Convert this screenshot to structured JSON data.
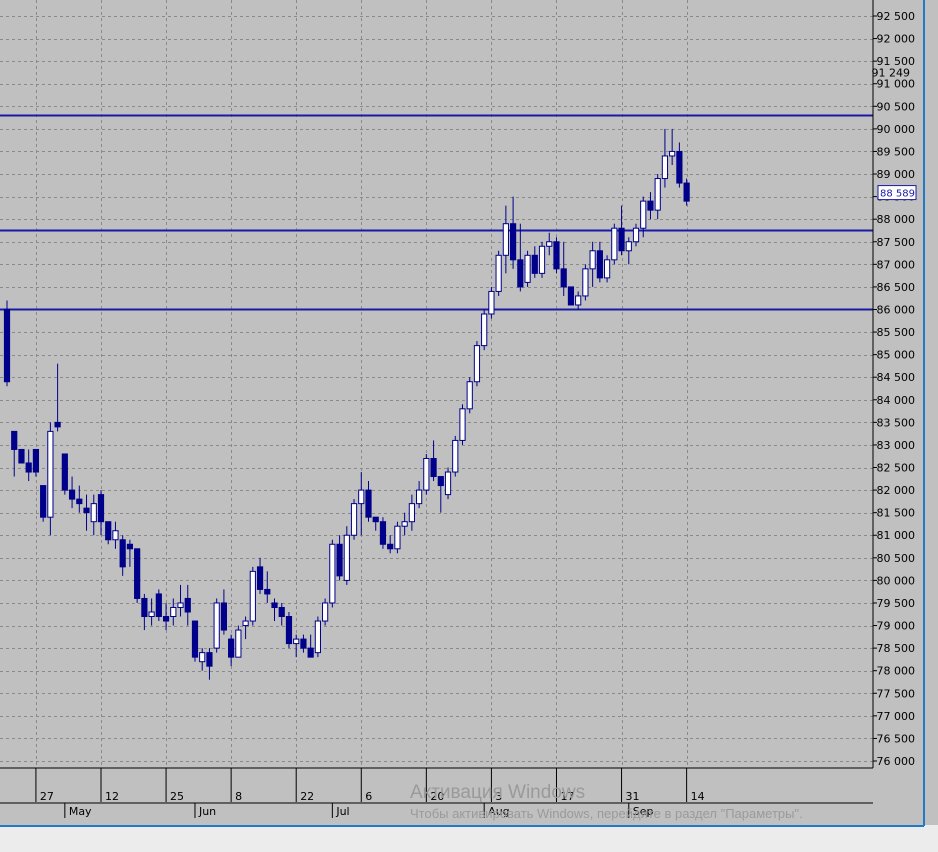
{
  "chart_data": {
    "type": "candlestick",
    "y_axis": {
      "range": [
        76000,
        92500
      ],
      "step": 500,
      "labels": [
        "92 500",
        "92 000",
        "91 500",
        "91 000",
        "90 500",
        "90 000",
        "89 500",
        "89 000",
        "88 500",
        "88 000",
        "87 500",
        "87 000",
        "86 500",
        "86 000",
        "85 500",
        "85 000",
        "84 500",
        "84 000",
        "83 500",
        "83 000",
        "82 500",
        "82 000",
        "81 500",
        "81 000",
        "80 500",
        "80 000",
        "79 500",
        "79 000",
        "78 500",
        "78 000",
        "77 500",
        "77 000",
        "76 500",
        "76 000"
      ]
    },
    "price_markers": [
      {
        "label": "91 249",
        "value": 91249
      },
      {
        "label": "88 589",
        "value": 88589
      }
    ],
    "horizontal_levels": [
      90300,
      87750,
      86000
    ],
    "x_axis": {
      "day_ticks": [
        {
          "label": "27",
          "bar": 4
        },
        {
          "label": "12",
          "bar": 13
        },
        {
          "label": "25",
          "bar": 22
        },
        {
          "label": "8",
          "bar": 31
        },
        {
          "label": "22",
          "bar": 40
        },
        {
          "label": "6",
          "bar": 49
        },
        {
          "label": "20",
          "bar": 58
        },
        {
          "label": "3",
          "bar": 67
        },
        {
          "label": "17",
          "bar": 76
        },
        {
          "label": "31",
          "bar": 85
        },
        {
          "label": "14",
          "bar": 94
        }
      ],
      "month_ticks": [
        {
          "label": "May",
          "bar": 8
        },
        {
          "label": "Jun",
          "bar": 26
        },
        {
          "label": "Jul",
          "bar": 45
        },
        {
          "label": "Aug",
          "bar": 66
        },
        {
          "label": "Sep",
          "bar": 86
        }
      ]
    },
    "candles": [
      {
        "o": 86000,
        "h": 86200,
        "l": 84300,
        "c": 84400
      },
      {
        "o": 83300,
        "h": 83300,
        "l": 82300,
        "c": 82900
      },
      {
        "o": 82900,
        "h": 82900,
        "l": 82600,
        "c": 82600
      },
      {
        "o": 82600,
        "h": 82900,
        "l": 82200,
        "c": 82400
      },
      {
        "o": 82900,
        "h": 82900,
        "l": 82300,
        "c": 82400
      },
      {
        "o": 82100,
        "h": 82100,
        "l": 81300,
        "c": 81400
      },
      {
        "o": 81400,
        "h": 83500,
        "l": 81000,
        "c": 83300
      },
      {
        "o": 83500,
        "h": 84800,
        "l": 83300,
        "c": 83400
      },
      {
        "o": 82800,
        "h": 82800,
        "l": 81900,
        "c": 82000
      },
      {
        "o": 82000,
        "h": 82300,
        "l": 81600,
        "c": 81800
      },
      {
        "o": 81800,
        "h": 82100,
        "l": 81500,
        "c": 81700
      },
      {
        "o": 81600,
        "h": 81900,
        "l": 81100,
        "c": 81500
      },
      {
        "o": 81300,
        "h": 81900,
        "l": 81000,
        "c": 81700
      },
      {
        "o": 81900,
        "h": 82000,
        "l": 81000,
        "c": 81300
      },
      {
        "o": 81300,
        "h": 81300,
        "l": 80800,
        "c": 80900
      },
      {
        "o": 80900,
        "h": 81300,
        "l": 80700,
        "c": 81100
      },
      {
        "o": 80900,
        "h": 81000,
        "l": 80100,
        "c": 80300
      },
      {
        "o": 80800,
        "h": 80900,
        "l": 80300,
        "c": 80700
      },
      {
        "o": 80700,
        "h": 80700,
        "l": 79500,
        "c": 79600
      },
      {
        "o": 79600,
        "h": 79700,
        "l": 78900,
        "c": 79200
      },
      {
        "o": 79200,
        "h": 79600,
        "l": 79000,
        "c": 79300
      },
      {
        "o": 79700,
        "h": 79800,
        "l": 79100,
        "c": 79200
      },
      {
        "o": 79200,
        "h": 79500,
        "l": 78900,
        "c": 79100
      },
      {
        "o": 79200,
        "h": 79600,
        "l": 79000,
        "c": 79400
      },
      {
        "o": 79400,
        "h": 79900,
        "l": 79200,
        "c": 79500
      },
      {
        "o": 79600,
        "h": 79900,
        "l": 79000,
        "c": 79300
      },
      {
        "o": 79100,
        "h": 79100,
        "l": 78200,
        "c": 78300
      },
      {
        "o": 78200,
        "h": 78500,
        "l": 78000,
        "c": 78400
      },
      {
        "o": 78400,
        "h": 78500,
        "l": 77800,
        "c": 78100
      },
      {
        "o": 78500,
        "h": 79600,
        "l": 78400,
        "c": 79500
      },
      {
        "o": 79500,
        "h": 79800,
        "l": 78800,
        "c": 78900
      },
      {
        "o": 78700,
        "h": 78800,
        "l": 78100,
        "c": 78300
      },
      {
        "o": 78300,
        "h": 79000,
        "l": 78300,
        "c": 78900
      },
      {
        "o": 79000,
        "h": 79200,
        "l": 78700,
        "c": 79100
      },
      {
        "o": 79100,
        "h": 80300,
        "l": 79000,
        "c": 80200
      },
      {
        "o": 80300,
        "h": 80500,
        "l": 79700,
        "c": 79800
      },
      {
        "o": 79800,
        "h": 80200,
        "l": 79500,
        "c": 79700
      },
      {
        "o": 79500,
        "h": 79600,
        "l": 79100,
        "c": 79400
      },
      {
        "o": 79400,
        "h": 79500,
        "l": 79000,
        "c": 79200
      },
      {
        "o": 79200,
        "h": 79300,
        "l": 78500,
        "c": 78600
      },
      {
        "o": 78600,
        "h": 78800,
        "l": 78300,
        "c": 78700
      },
      {
        "o": 78700,
        "h": 78800,
        "l": 78400,
        "c": 78500
      },
      {
        "o": 78500,
        "h": 78800,
        "l": 78300,
        "c": 78300
      },
      {
        "o": 78400,
        "h": 79200,
        "l": 78300,
        "c": 79100
      },
      {
        "o": 79100,
        "h": 79600,
        "l": 79000,
        "c": 79500
      },
      {
        "o": 79500,
        "h": 80900,
        "l": 79400,
        "c": 80800
      },
      {
        "o": 80800,
        "h": 81000,
        "l": 80000,
        "c": 80100
      },
      {
        "o": 80000,
        "h": 81200,
        "l": 79900,
        "c": 81000
      },
      {
        "o": 81000,
        "h": 81800,
        "l": 80900,
        "c": 81700
      },
      {
        "o": 81700,
        "h": 82400,
        "l": 81000,
        "c": 82000
      },
      {
        "o": 82000,
        "h": 82200,
        "l": 81300,
        "c": 81400
      },
      {
        "o": 81400,
        "h": 81400,
        "l": 81100,
        "c": 81300
      },
      {
        "o": 81300,
        "h": 81400,
        "l": 80700,
        "c": 80800
      },
      {
        "o": 80800,
        "h": 81000,
        "l": 80600,
        "c": 80700
      },
      {
        "o": 80700,
        "h": 81300,
        "l": 80600,
        "c": 81200
      },
      {
        "o": 81200,
        "h": 81500,
        "l": 81000,
        "c": 81300
      },
      {
        "o": 81300,
        "h": 81900,
        "l": 81100,
        "c": 81700
      },
      {
        "o": 81700,
        "h": 82200,
        "l": 81600,
        "c": 82000
      },
      {
        "o": 82000,
        "h": 82800,
        "l": 81900,
        "c": 82700
      },
      {
        "o": 82700,
        "h": 83100,
        "l": 82200,
        "c": 82300
      },
      {
        "o": 82300,
        "h": 82300,
        "l": 81500,
        "c": 82100
      },
      {
        "o": 81900,
        "h": 82500,
        "l": 81800,
        "c": 82400
      },
      {
        "o": 82400,
        "h": 83200,
        "l": 82300,
        "c": 83100
      },
      {
        "o": 83100,
        "h": 83900,
        "l": 83000,
        "c": 83800
      },
      {
        "o": 83800,
        "h": 84500,
        "l": 83700,
        "c": 84400
      },
      {
        "o": 84400,
        "h": 85300,
        "l": 84300,
        "c": 85200
      },
      {
        "o": 85200,
        "h": 86000,
        "l": 85100,
        "c": 85900
      },
      {
        "o": 85900,
        "h": 86500,
        "l": 85800,
        "c": 86400
      },
      {
        "o": 86400,
        "h": 87300,
        "l": 86300,
        "c": 87200
      },
      {
        "o": 87200,
        "h": 88300,
        "l": 86800,
        "c": 87900
      },
      {
        "o": 87900,
        "h": 88500,
        "l": 86900,
        "c": 87100
      },
      {
        "o": 87100,
        "h": 87900,
        "l": 86400,
        "c": 86500
      },
      {
        "o": 86600,
        "h": 87300,
        "l": 86500,
        "c": 87200
      },
      {
        "o": 87200,
        "h": 87400,
        "l": 86700,
        "c": 86800
      },
      {
        "o": 86800,
        "h": 87500,
        "l": 86700,
        "c": 87400
      },
      {
        "o": 87400,
        "h": 87700,
        "l": 87200,
        "c": 87500
      },
      {
        "o": 87500,
        "h": 87600,
        "l": 86800,
        "c": 86900
      },
      {
        "o": 86900,
        "h": 87500,
        "l": 86300,
        "c": 86500
      },
      {
        "o": 86500,
        "h": 86500,
        "l": 86100,
        "c": 86100
      },
      {
        "o": 86100,
        "h": 86400,
        "l": 86000,
        "c": 86300
      },
      {
        "o": 86300,
        "h": 87000,
        "l": 86200,
        "c": 86900
      },
      {
        "o": 86900,
        "h": 87500,
        "l": 86500,
        "c": 87300
      },
      {
        "o": 87300,
        "h": 87500,
        "l": 86600,
        "c": 86700
      },
      {
        "o": 86700,
        "h": 87200,
        "l": 86600,
        "c": 87100
      },
      {
        "o": 87100,
        "h": 87900,
        "l": 87000,
        "c": 87800
      },
      {
        "o": 87800,
        "h": 88300,
        "l": 87200,
        "c": 87300
      },
      {
        "o": 87300,
        "h": 87600,
        "l": 87000,
        "c": 87500
      },
      {
        "o": 87500,
        "h": 87900,
        "l": 87400,
        "c": 87800
      },
      {
        "o": 87800,
        "h": 88500,
        "l": 87600,
        "c": 88400
      },
      {
        "o": 88400,
        "h": 88600,
        "l": 88000,
        "c": 88200
      },
      {
        "o": 88200,
        "h": 89000,
        "l": 88000,
        "c": 88900
      },
      {
        "o": 88900,
        "h": 90000,
        "l": 88700,
        "c": 89400
      },
      {
        "o": 89400,
        "h": 90000,
        "l": 89200,
        "c": 89500
      },
      {
        "o": 89500,
        "h": 89700,
        "l": 88700,
        "c": 88800
      },
      {
        "o": 88800,
        "h": 88900,
        "l": 88300,
        "c": 88400
      }
    ]
  },
  "watermark": {
    "line1": "Активация Windows",
    "line2": "Чтобы активировать Windows, перейдите в раздел \"Параметры\"."
  },
  "colors": {
    "background": "#c0c0c0",
    "grid": "#8a8a8a",
    "candle": "#00008b",
    "level_line": "#1a1aa8",
    "axis_text": "#000000",
    "window_border": "#1f79c7"
  }
}
